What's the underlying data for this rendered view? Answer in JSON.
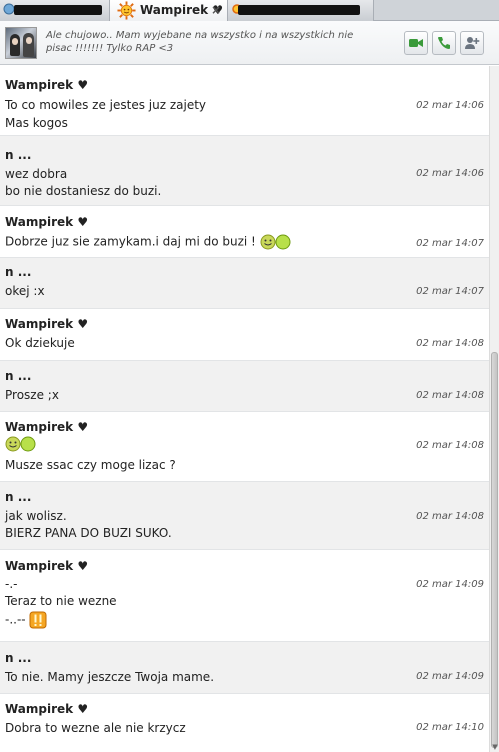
{
  "tabs": [
    {
      "label": "",
      "redacted": true
    },
    {
      "label": "Wampirek ♥",
      "active": true,
      "close": "×"
    },
    {
      "label": "",
      "redacted": true
    }
  ],
  "header": {
    "status_line1": "Ale chujowo.. Mam wyjebane na wszystko i na wszystkich nie",
    "status_line2": "pisac !!!!!!! Tylko RAP <3",
    "buttons": [
      "video-call-icon",
      "phone-call-icon",
      "add-contact-icon"
    ],
    "colors": {
      "video": "#3a9a3a",
      "phone": "#3a9a3a",
      "add": "#6b7480"
    }
  },
  "messages": [
    {
      "author": "Wampirek",
      "heart": "♥",
      "time": "02 mar 14:06",
      "lines": [
        "To co mowiles ze jestes juz zajety",
        "Mas kogos"
      ],
      "bg": "white"
    },
    {
      "author": "n ...",
      "heart": "",
      "time": "02 mar 14:06",
      "lines": [
        "wez dobra",
        "bo nie dostaniesz do buzi."
      ],
      "bg": "gray"
    },
    {
      "author": "Wampirek",
      "heart": "♥",
      "time": "02 mar 14:07",
      "lines": [
        "Dobrze juz sie zamykam.i daj mi do buzi !"
      ],
      "bg": "white",
      "emoticon": "smiley-ball"
    },
    {
      "author": "n ...",
      "heart": "",
      "time": "02 mar 14:07",
      "lines": [
        "okej :x"
      ],
      "bg": "gray"
    },
    {
      "author": "Wampirek",
      "heart": "♥",
      "time": "02 mar 14:08",
      "lines": [
        "Ok dziekuje"
      ],
      "bg": "white"
    },
    {
      "author": "n ...",
      "heart": "",
      "time": "02 mar 14:08",
      "lines": [
        "Prosze ;x"
      ],
      "bg": "gray"
    },
    {
      "author": "Wampirek",
      "heart": "♥",
      "time": "02 mar 14:08",
      "lines": [
        "",
        "Musze ssac czy moge lizac ?"
      ],
      "bg": "white",
      "emoticon_line0": "smiley-ball"
    },
    {
      "author": "n ...",
      "heart": "",
      "time": "02 mar 14:08",
      "lines": [
        "jak wolisz.",
        "BIERZ PANA DO BUZI SUKO."
      ],
      "bg": "gray"
    },
    {
      "author": "Wampirek",
      "heart": "♥",
      "time": "02 mar 14:09",
      "lines": [
        "-.-",
        "Teraz to nie wezne",
        "-..--"
      ],
      "bg": "white",
      "emoticon_last": "exclamation"
    },
    {
      "author": "n ...",
      "heart": "",
      "time": "02 mar 14:09",
      "lines": [
        "To nie. Mamy jeszcze Twoja mame."
      ],
      "bg": "gray"
    },
    {
      "author": "Wampirek",
      "heart": "♥",
      "time": "02 mar 14:10",
      "lines": [
        "Dobra to wezne ale nie krzycz"
      ],
      "bg": "white"
    }
  ]
}
